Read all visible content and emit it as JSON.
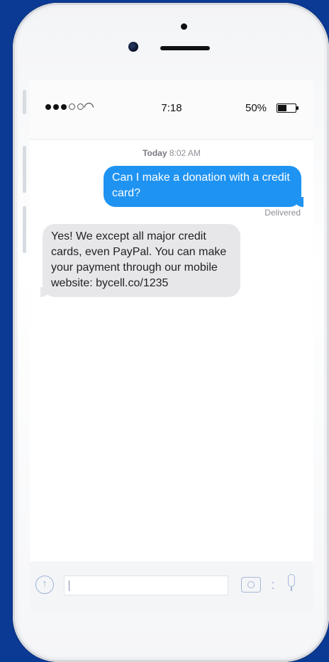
{
  "theme": {
    "bg": "#0b3a94",
    "bubble_out": "#1f93f2",
    "bubble_in": "#e7e7ea"
  },
  "status_bar": {
    "signal": "●●●○○",
    "time": "7:18",
    "battery_text": "50%",
    "battery_level": 0.5
  },
  "conversation": {
    "timestamp_day": "Today",
    "timestamp_time": "8:02 AM",
    "outgoing": "Can I make a donation with a credit card?",
    "delivered_label": "Delivered",
    "incoming": "Yes! We except all major credit cards, even PayPal. You can make your payment through our mobile website: bycell.co/1235"
  },
  "composer": {
    "placeholder": "",
    "icons": [
      "up-arrow-icon",
      "camera-icon",
      "more-icon",
      "microphone-icon"
    ]
  }
}
